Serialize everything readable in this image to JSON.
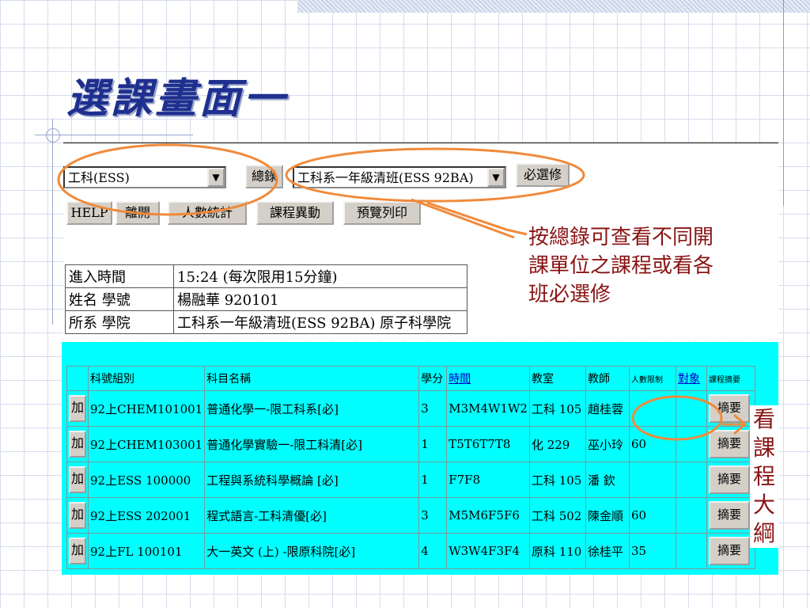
{
  "slide": {
    "title": "選課畫面一"
  },
  "controls": {
    "dept_select": "工科(ESS)",
    "total_button": "總錄",
    "class_select": "工科系一年級清班(ESS 92BA)",
    "required_button": "必選修",
    "buttons": [
      "HELP",
      "離開",
      "人數統計",
      "課程異動",
      "預覽列印"
    ]
  },
  "info": {
    "rows": [
      {
        "label": "進入時間",
        "value": "15:24 (每次限用15分鐘)"
      },
      {
        "label": "姓名 學號",
        "value": "楊融華 920101"
      },
      {
        "label": "所系 學院",
        "value": "工科系一年級清班(ESS 92BA) 原子科學院"
      }
    ]
  },
  "table": {
    "headers": [
      "科號組別",
      "科目名稱",
      "學分",
      "時間",
      "教室",
      "教師",
      "人數限制",
      "對象",
      "課程摘要"
    ],
    "add_label": "加",
    "summary_label": "摘要",
    "rows": [
      {
        "code": "92上CHEM101001",
        "name": "普通化學一-限工科系[必]",
        "credits": "3",
        "time": "M3M4W1W2",
        "room": "工科 105",
        "teacher": "趙桂蓉",
        "limit": ""
      },
      {
        "code": "92上CHEM103001",
        "name": "普通化學實驗一-限工科清[必]",
        "credits": "1",
        "time": "T5T6T7T8",
        "room": "化 229",
        "teacher": "巫小玲",
        "limit": "60"
      },
      {
        "code": "92上ESS 100000",
        "name": "工程與系統科學概論 [必]",
        "credits": "1",
        "time": "F7F8",
        "room": "工科 105",
        "teacher": "潘 欽",
        "limit": ""
      },
      {
        "code": "92上ESS 202001",
        "name": "程式語言-工科清優[必]",
        "credits": "3",
        "time": "M5M6F5F6",
        "room": "工科 502",
        "teacher": "陳金順",
        "limit": "60"
      },
      {
        "code": "92上FL 100101",
        "name": "大一英文 (上) -限原科院[必]",
        "credits": "4",
        "time": "W3W4F3F4",
        "room": "原科 110",
        "teacher": "徐桂平",
        "limit": "35"
      }
    ]
  },
  "annotations": {
    "right_note": [
      "按總錄可查看不同開",
      "課單位之課程或看各",
      "班必選修"
    ],
    "vertical_note": [
      "看",
      "課",
      "程",
      "大",
      "綱"
    ]
  },
  "colors": {
    "title": "#1f2f8f",
    "annotation": "#8a1414",
    "oval": "#f08a3c",
    "grid_bg": "#00ffff"
  }
}
